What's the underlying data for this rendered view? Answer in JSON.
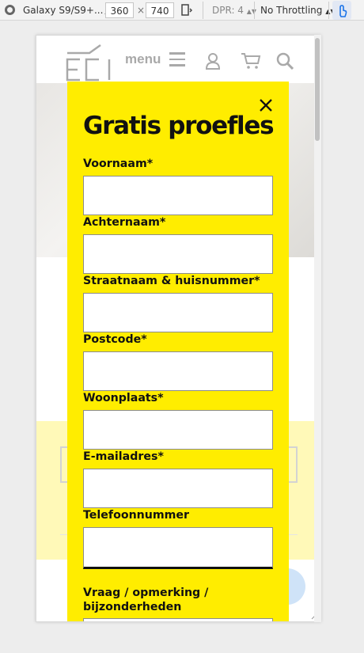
{
  "devtools": {
    "device": "Galaxy S9/S9+...",
    "width": "360",
    "times": "×",
    "height": "740",
    "dpr": "DPR: 4",
    "throttling": "No Throttling"
  },
  "header": {
    "menu_label": "menu",
    "logo_text": "ECI"
  },
  "modal": {
    "title": "Gratis proefles",
    "fields": [
      {
        "label": "Voornaam*",
        "value": ""
      },
      {
        "label": "Achternaam*",
        "value": ""
      },
      {
        "label": "Straatnaam & huisnummer*",
        "value": ""
      },
      {
        "label": "Postcode*",
        "value": ""
      },
      {
        "label": "Woonplaats*",
        "value": ""
      },
      {
        "label": "E-mailadres*",
        "value": ""
      },
      {
        "label": "Telefoonnummer",
        "value": ""
      }
    ],
    "message_label_line1": "Vraag / opmerking /",
    "message_label_line2": "bijzonderheden"
  },
  "colors": {
    "modal_bg": "#ffed00",
    "text": "#111111"
  }
}
